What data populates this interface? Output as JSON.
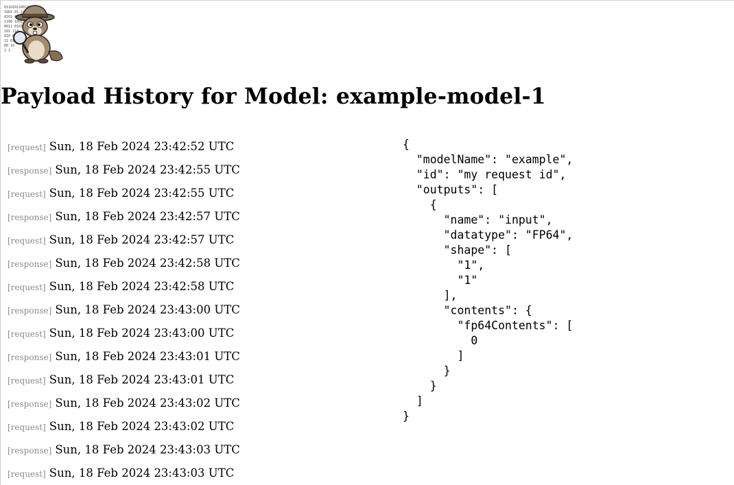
{
  "page": {
    "title": "Payload History for Model: example-model-1"
  },
  "history": [
    {
      "kind": "[request]",
      "timestamp": "Sun, 18 Feb 2024 23:42:52 UTC"
    },
    {
      "kind": "[response]",
      "timestamp": "Sun, 18 Feb 2024 23:42:55 UTC"
    },
    {
      "kind": "[request]",
      "timestamp": "Sun, 18 Feb 2024 23:42:55 UTC"
    },
    {
      "kind": "[response]",
      "timestamp": "Sun, 18 Feb 2024 23:42:57 UTC"
    },
    {
      "kind": "[request]",
      "timestamp": "Sun, 18 Feb 2024 23:42:57 UTC"
    },
    {
      "kind": "[response]",
      "timestamp": "Sun, 18 Feb 2024 23:42:58 UTC"
    },
    {
      "kind": "[request]",
      "timestamp": "Sun, 18 Feb 2024 23:42:58 UTC"
    },
    {
      "kind": "[response]",
      "timestamp": "Sun, 18 Feb 2024 23:43:00 UTC"
    },
    {
      "kind": "[request]",
      "timestamp": "Sun, 18 Feb 2024 23:43:00 UTC"
    },
    {
      "kind": "[response]",
      "timestamp": "Sun, 18 Feb 2024 23:43:01 UTC"
    },
    {
      "kind": "[request]",
      "timestamp": "Sun, 18 Feb 2024 23:43:01 UTC"
    },
    {
      "kind": "[response]",
      "timestamp": "Sun, 18 Feb 2024 23:43:02 UTC"
    },
    {
      "kind": "[request]",
      "timestamp": "Sun, 18 Feb 2024 23:43:02 UTC"
    },
    {
      "kind": "[response]",
      "timestamp": "Sun, 18 Feb 2024 23:43:03 UTC"
    },
    {
      "kind": "[request]",
      "timestamp": "Sun, 18 Feb 2024 23:43:03 UTC"
    }
  ],
  "payload": {
    "text": "{\n  \"modelName\": \"example\",\n  \"id\": \"my request id\",\n  \"outputs\": [\n    {\n      \"name\": \"input\",\n      \"datatype\": \"FP64\",\n      \"shape\": [\n        \"1\",\n        \"1\"\n      ],\n      \"contents\": {\n        \"fp64Contents\": [\n          0\n        ]\n      }\n    }\n  ]\n}"
  },
  "logo": {
    "icon": "groundhog-detective-logo",
    "binary_text": "010110 100101 001011 110010 011001 101100"
  },
  "colors": {
    "kind_label": "#8a8a8a",
    "text": "#000000",
    "background": "#ffffff"
  }
}
